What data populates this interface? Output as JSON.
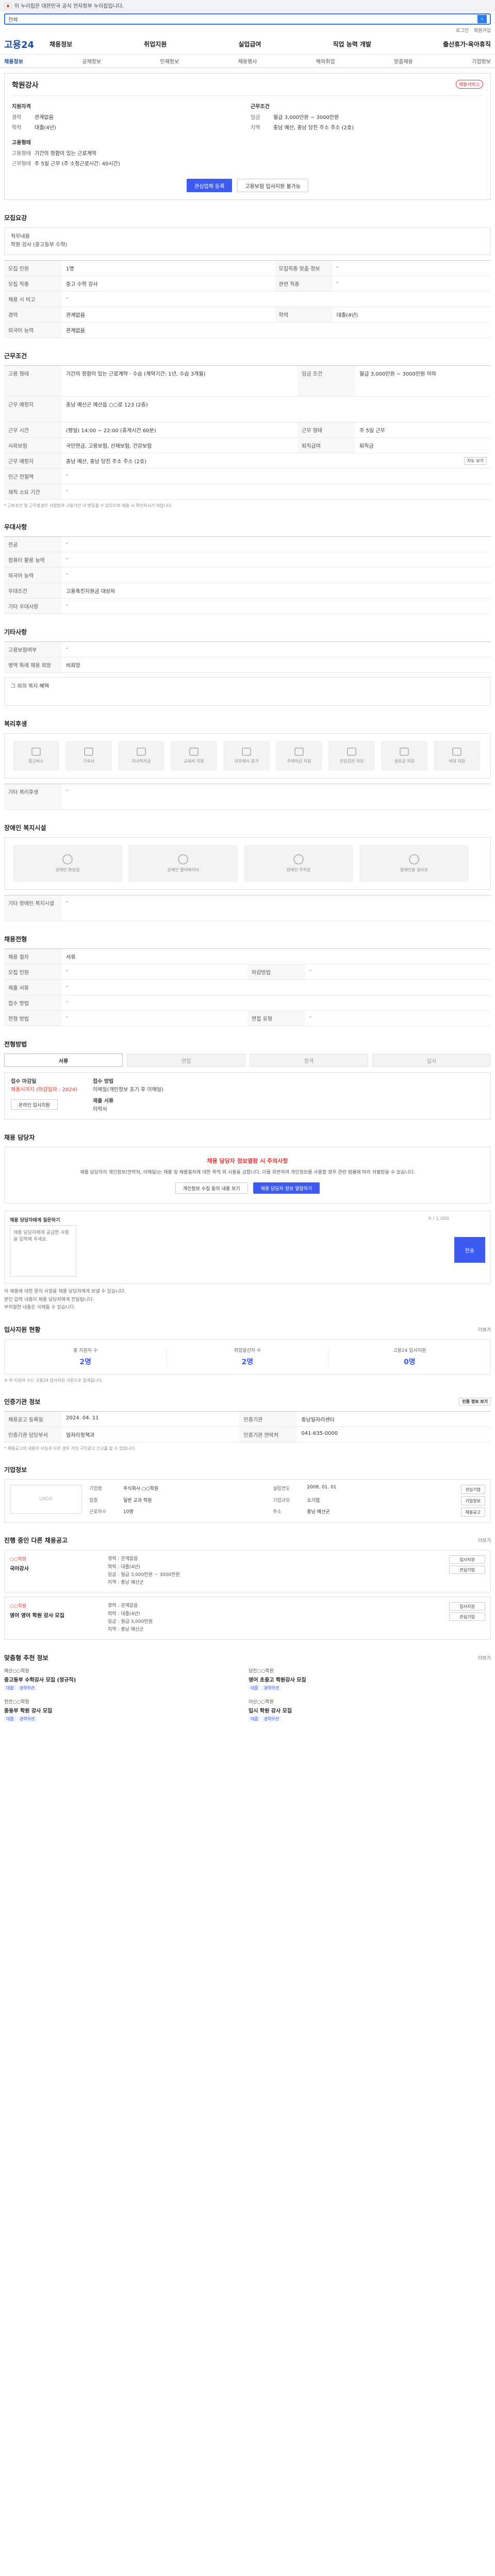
{
  "topbar": {
    "text": "이 누리집은 대한민국 공식 전자정부 누리집입니다."
  },
  "search": {
    "category": "전체",
    "placeholder": "",
    "button": "검색"
  },
  "util": [
    "로그인",
    "회원가입"
  ],
  "gnb": {
    "logo": "고용24",
    "menu": [
      "채용정보",
      "취업지원",
      "실업급여",
      "직업 능력 개발",
      "출산휴가·육아휴직"
    ]
  },
  "subnav": [
    "채용정보",
    "공채정보",
    "인재정보",
    "채용행사",
    "해외취업",
    "맞춤채용",
    "기업정보"
  ],
  "hero": {
    "title": "학원강사",
    "badge": "채용서비스",
    "col1_head": "지원자격",
    "col1": [
      {
        "k": "경력",
        "v": "관계없음"
      },
      {
        "k": "학력",
        "v": "대졸(4년)"
      }
    ],
    "col2_head": "근무조건",
    "col2": [
      {
        "k": "임금",
        "v": "월급 3,000만원 ~ 3000만원"
      },
      {
        "k": "지역",
        "v": "충남 예산, 충남 당진 주소 주소 (2호)"
      }
    ],
    "col3_head": "고용형태",
    "col3": [
      {
        "k": "고용형태",
        "v": "기간의 정함이 있는 근로계약"
      },
      {
        "k": "근무형태",
        "v": "주 5일 근무 (주 소정근로시간: 40시간)"
      }
    ],
    "btn_apply": "관심업체 등록",
    "btn_other": "고용보험 입사지원 불가능"
  },
  "duty": {
    "title": "모집요강",
    "job_title": "직무내용",
    "job_desc": "학원 강사 (중고등부 수학)"
  },
  "recruit_table": {
    "rows": [
      [
        {
          "k": "모집 인원",
          "v": "1명"
        },
        {
          "k": "모집직종 맞춤 정보",
          "v": "-"
        }
      ],
      [
        {
          "k": "모집 직종",
          "v": "중고 수학 강사"
        },
        {
          "k": "관련 직종",
          "v": "-"
        }
      ],
      [
        {
          "k": "채용 시 비고",
          "v": "-"
        },
        {
          "k": "",
          "v": ""
        }
      ],
      [
        {
          "k": "경력",
          "v": "관계없음"
        },
        {
          "k": "학력",
          "v": "대졸(4년)"
        }
      ],
      [
        {
          "k": "외국어 능력",
          "v": "관계없음"
        },
        {
          "k": "",
          "v": ""
        }
      ]
    ]
  },
  "conditions": {
    "title": "근무조건",
    "rows": [
      {
        "k": "고용 형태",
        "v": "기간의 정함이 있는 근로계약 · 수습 (계약기간: 1년, 수습 3개월)",
        "k2": "임금 조건",
        "v2": "월급 3,000만원 ~ 3000만원 이하"
      },
      {
        "k": "근무 예정지",
        "v": "충남 예산군 예산읍 ○○로 123 (2층)",
        "k2": "",
        "v2": ""
      },
      {
        "k": "근무 시간",
        "v": "(평일) 14:00 ~ 22:00 (휴게시간 60분)",
        "k2": "근무 형태",
        "v2": "주 5일 근무"
      },
      {
        "k": "사회보험",
        "v": "국민연금, 고용보험, 산재보험, 건강보험",
        "k2": "퇴직급여",
        "v2": "퇴직금"
      },
      {
        "k": "근무 예정지",
        "v": "충남 예산, 충남 당진 주소 주소 (2호)",
        "k2": "",
        "v2": ""
      },
      {
        "k": "인근 전철역",
        "v": "-",
        "k2": "",
        "v2": ""
      },
      {
        "k": "재직 소요 기간",
        "v": "-",
        "k2": "",
        "v2": ""
      }
    ],
    "map_btn": "지도 보기",
    "note": "* 근로조건 및 근무환경은 사업장과 고용기간 내 변동될 수 있으므로 채용 시 확인하시기 바랍니다."
  },
  "prefer": {
    "title": "우대사항",
    "rows": [
      {
        "k": "전공",
        "v": "-"
      },
      {
        "k": "컴퓨터 활용 능력",
        "v": "-"
      },
      {
        "k": "외국어 능력",
        "v": "-"
      },
      {
        "k": "우대조건",
        "v": "고용촉진지원금 대상자"
      },
      {
        "k": "기타 우대사항",
        "v": "-"
      }
    ]
  },
  "etc": {
    "title": "기타사항",
    "rows": [
      {
        "k": "고용보험여부",
        "v": "-"
      },
      {
        "k": "병역 특례 채용 희망",
        "v": "비희망"
      }
    ],
    "extra": "그 외의 복지 혜택"
  },
  "welfare": {
    "title": "복리후생",
    "items": [
      "통근버스",
      "기숙사",
      "자녀학자금",
      "교육비 지원",
      "리프레시 휴가",
      "주택자금 지원",
      "건강검진 지원",
      "경조금 지원",
      "식대 지원"
    ],
    "other_label": "기타 복리후생",
    "other_value": "-"
  },
  "disability": {
    "title": "장애인 복지시설",
    "items": [
      "장애인 화장실",
      "장애인 엘리베이터",
      "장애인 주차장",
      "장애인용 경사로"
    ],
    "other_label": "기타 장애인 복지시설",
    "other_value": "-"
  },
  "process": {
    "title": "채용전형",
    "rows": [
      [
        {
          "k": "채용 절차",
          "v": "서류"
        },
        {
          "k": "",
          "v": ""
        }
      ],
      [
        {
          "k": "모집 인원",
          "v": "-"
        },
        {
          "k": "마감방법",
          "v": "-"
        }
      ],
      [
        {
          "k": "제출 서류",
          "v": "-"
        },
        {
          "k": "",
          "v": ""
        }
      ],
      [
        {
          "k": "접수 방법",
          "v": "-"
        },
        {
          "k": "",
          "v": ""
        }
      ],
      [
        {
          "k": "전형 방법",
          "v": "-"
        },
        {
          "k": "면접 유형",
          "v": "-"
        }
      ]
    ]
  },
  "apply": {
    "title": "전형방법",
    "steps": [
      "서류",
      "면접",
      "합격",
      "입사"
    ],
    "deadline_label": "접수 마감일",
    "deadline": "채용시까지 (마감일자 : 2024)",
    "method_label": "접수 방법",
    "method": "이메일(개인정보 포기 후 이메일)",
    "receipt_label": "제출 서류",
    "receipt": "이력서",
    "apply_btn": "온라인 입사지원"
  },
  "notice": {
    "title": "채용 담당자",
    "warn": "채용 담당자 정보열람 시 주의사항",
    "desc": "채용 담당자의 개인정보(연락처, 이메일)는 채용 및 채용절차에 대한 목적 외 사용을 금합니다. 이를 위반하여 개인정보를 사용할 경우 관련 법률에 따라 처벌받을 수 있습니다.",
    "btn_agree": "개인정보 수집 동의 내용 보기",
    "btn_view": "채용 담당자 정보 열람하기"
  },
  "inquiry": {
    "title": "채용 담당자에게 질문하기",
    "counter": "0 / 1,000",
    "placeholder": "채용 담당자에게 궁금한 사항을 입력해 주세요.",
    "send": "전송",
    "notes": [
      "이 채용에 대한 문의 사항을 채용 담당자에게 보낼 수 있습니다.",
      "본인 입력 내용이 채용 담당자에게 전달됩니다.",
      "부적절한 내용은 삭제될 수 있습니다."
    ]
  },
  "stats": {
    "title": "입사지원 현황",
    "more": "더보기",
    "items": [
      {
        "l": "총 지원자 수",
        "n": "2명"
      },
      {
        "l": "취업알선자 수",
        "n": "2명"
      },
      {
        "l": "고용24 입사지원",
        "n": "0명"
      }
    ],
    "note": "※ 위 지원자 수는 고용24 입사지원 기준으로 집계됩니다."
  },
  "reg": {
    "title": "인증기관 정보",
    "btn": "인증 정보 보기",
    "rows": [
      [
        {
          "k": "채용공고 등록일",
          "v": "2024. 04. 11"
        },
        {
          "k": "인증기관",
          "v": "충남일자리센터"
        }
      ],
      [
        {
          "k": "인증기관 담당부서",
          "v": "일자리정책과"
        },
        {
          "k": "인증기관 연락처",
          "v": "041-635-0000"
        }
      ]
    ],
    "note": "* 채용공고의 내용이 사실과 다른 경우 거짓 구인광고 신고를 할 수 있습니다."
  },
  "company": {
    "title": "기업정보",
    "logo": "LOGO",
    "fields": [
      {
        "k": "기업명",
        "v": "주식회사 ○○학원"
      },
      {
        "k": "설립연도",
        "v": "2008. 01. 01"
      },
      {
        "k": "업종",
        "v": "일반 교과 학원"
      },
      {
        "k": "기업규모",
        "v": "소기업"
      },
      {
        "k": "근로자수",
        "v": "10명"
      },
      {
        "k": "주소",
        "v": "충남 예산군"
      }
    ],
    "btns": [
      "관심기업",
      "기업정보",
      "채용공고"
    ]
  },
  "jobs": {
    "title": "진행 중인 다른 채용공고",
    "more": "더보기",
    "items": [
      {
        "c": "○○학원",
        "t": "국어강사",
        "d": [
          "경력 : 관계없음",
          "학력 : 대졸(4년)",
          "임금 : 월급 3,000만원 ~ 3000만원",
          "지역 : 충남 예산군"
        ]
      },
      {
        "c": "○○학원",
        "t": "영어 영어 학원 강사 모집",
        "d": [
          "경력 : 관계없음",
          "학력 : 대졸(4년)",
          "임금 : 월급 3,000만원",
          "지역 : 충남 예산군"
        ]
      }
    ],
    "btns": [
      "입사지원",
      "관심기업"
    ]
  },
  "reco": {
    "title": "맞춤형 추천 정보",
    "more": "더보기",
    "items": [
      {
        "c": "예산○○학원",
        "t": "중고등부 수학강사 모집 (정규직)",
        "tags": [
          "대졸",
          "경력무관"
        ]
      },
      {
        "c": "당진○○학원",
        "t": "영어 초중고 학원강사 모집",
        "tags": [
          "대졸",
          "경력무관"
        ]
      },
      {
        "c": "천안○○학원",
        "t": "중등부 학원 강사 모집",
        "tags": [
          "대졸",
          "경력무관"
        ]
      },
      {
        "c": "아산○○학원",
        "t": "입시 학원 강사 모집",
        "tags": [
          "대졸",
          "경력무관"
        ]
      }
    ]
  }
}
